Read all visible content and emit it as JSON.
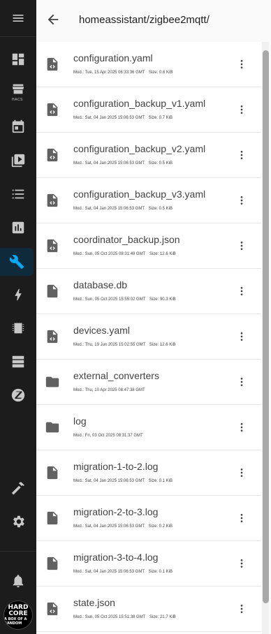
{
  "header": {
    "path": "homeassistant/zigbee2mqtt/"
  },
  "sidebar": {
    "hacs_label": "HACS",
    "avatar_line1": "HARD",
    "avatar_line2": "CORE",
    "avatar_line3": "A BOX OF A RANDOM"
  },
  "files": [
    {
      "name": "configuration.yaml",
      "modified": "Mod.: Tue, 15 Apr 2025 06:33:36 GMT",
      "size": "Size: 0.6 KiB",
      "icon": "code-file-icon"
    },
    {
      "name": "configuration_backup_v1.yaml",
      "modified": "Mod.: Sat, 04 Jan 2025 15:06:53 GMT",
      "size": "Size: 0.7 KiB",
      "icon": "code-file-icon"
    },
    {
      "name": "configuration_backup_v2.yaml",
      "modified": "Mod.: Sat, 04 Jan 2025 15:06:53 GMT",
      "size": "Size: 0.5 KiB",
      "icon": "code-file-icon"
    },
    {
      "name": "configuration_backup_v3.yaml",
      "modified": "Mod.: Sat, 04 Jan 2025 15:06:53 GMT",
      "size": "Size: 0.5 KiB",
      "icon": "code-file-icon"
    },
    {
      "name": "coordinator_backup.json",
      "modified": "Mod.: Sun, 05 Oct 2025 08:31:49 GMT",
      "size": "Size: 12.6 KiB",
      "icon": "code-file-icon"
    },
    {
      "name": "database.db",
      "modified": "Mod.: Sun, 05 Oct 2025 15:55:02 GMT",
      "size": "Size: 90.3 KiB",
      "icon": "file-icon"
    },
    {
      "name": "devices.yaml",
      "modified": "Mod.: Thu, 19 Jun 2025 15:02:55 GMT",
      "size": "Size: 12.6 KiB",
      "icon": "code-file-icon"
    },
    {
      "name": "external_converters",
      "modified": "Mod.: Thu, 10 Apr 2025 08:47:38 GMT",
      "size": "",
      "icon": "folder-icon"
    },
    {
      "name": "log",
      "modified": "Mod.: Fri, 03 Oct 2025 08:31:37 GMT",
      "size": "",
      "icon": "folder-icon"
    },
    {
      "name": "migration-1-to-2.log",
      "modified": "Mod.: Sat, 04 Jan 2025 15:06:53 GMT",
      "size": "Size: 0.1 KiB",
      "icon": "file-icon"
    },
    {
      "name": "migration-2-to-3.log",
      "modified": "Mod.: Sat, 04 Jan 2025 15:06:53 GMT",
      "size": "Size: 0.2 KiB",
      "icon": "file-icon"
    },
    {
      "name": "migration-3-to-4.log",
      "modified": "Mod.: Sat, 04 Jan 2025 15:06:53 GMT",
      "size": "Size: 0.1 KiB",
      "icon": "file-icon"
    },
    {
      "name": "state.json",
      "modified": "Mod.: Sun, 05 Oct 2025 15:51:38 GMT",
      "size": "Size: 21.7 KiB",
      "icon": "code-file-icon"
    }
  ]
}
